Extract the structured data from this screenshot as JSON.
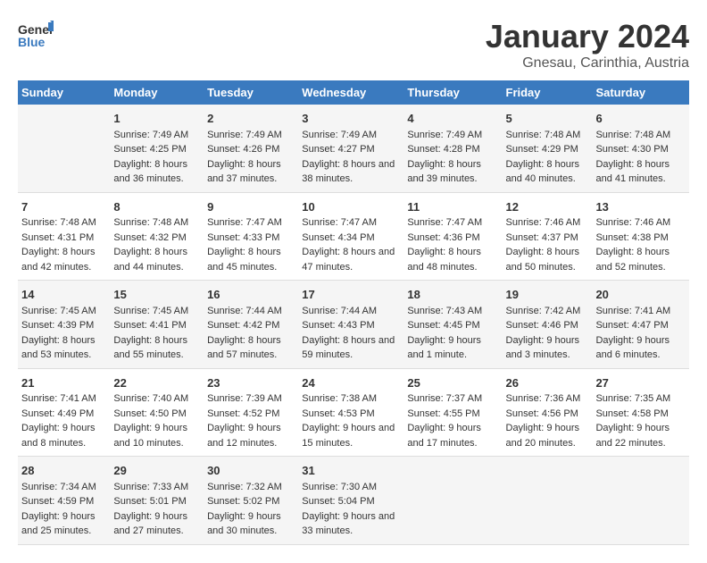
{
  "header": {
    "logo_general": "General",
    "logo_blue": "Blue",
    "main_title": "January 2024",
    "subtitle": "Gnesau, Carinthia, Austria"
  },
  "calendar": {
    "days_of_week": [
      "Sunday",
      "Monday",
      "Tuesday",
      "Wednesday",
      "Thursday",
      "Friday",
      "Saturday"
    ],
    "weeks": [
      [
        {
          "date": "",
          "sunrise": "",
          "sunset": "",
          "daylight": ""
        },
        {
          "date": "1",
          "sunrise": "Sunrise: 7:49 AM",
          "sunset": "Sunset: 4:25 PM",
          "daylight": "Daylight: 8 hours and 36 minutes."
        },
        {
          "date": "2",
          "sunrise": "Sunrise: 7:49 AM",
          "sunset": "Sunset: 4:26 PM",
          "daylight": "Daylight: 8 hours and 37 minutes."
        },
        {
          "date": "3",
          "sunrise": "Sunrise: 7:49 AM",
          "sunset": "Sunset: 4:27 PM",
          "daylight": "Daylight: 8 hours and 38 minutes."
        },
        {
          "date": "4",
          "sunrise": "Sunrise: 7:49 AM",
          "sunset": "Sunset: 4:28 PM",
          "daylight": "Daylight: 8 hours and 39 minutes."
        },
        {
          "date": "5",
          "sunrise": "Sunrise: 7:48 AM",
          "sunset": "Sunset: 4:29 PM",
          "daylight": "Daylight: 8 hours and 40 minutes."
        },
        {
          "date": "6",
          "sunrise": "Sunrise: 7:48 AM",
          "sunset": "Sunset: 4:30 PM",
          "daylight": "Daylight: 8 hours and 41 minutes."
        }
      ],
      [
        {
          "date": "7",
          "sunrise": "Sunrise: 7:48 AM",
          "sunset": "Sunset: 4:31 PM",
          "daylight": "Daylight: 8 hours and 42 minutes."
        },
        {
          "date": "8",
          "sunrise": "Sunrise: 7:48 AM",
          "sunset": "Sunset: 4:32 PM",
          "daylight": "Daylight: 8 hours and 44 minutes."
        },
        {
          "date": "9",
          "sunrise": "Sunrise: 7:47 AM",
          "sunset": "Sunset: 4:33 PM",
          "daylight": "Daylight: 8 hours and 45 minutes."
        },
        {
          "date": "10",
          "sunrise": "Sunrise: 7:47 AM",
          "sunset": "Sunset: 4:34 PM",
          "daylight": "Daylight: 8 hours and 47 minutes."
        },
        {
          "date": "11",
          "sunrise": "Sunrise: 7:47 AM",
          "sunset": "Sunset: 4:36 PM",
          "daylight": "Daylight: 8 hours and 48 minutes."
        },
        {
          "date": "12",
          "sunrise": "Sunrise: 7:46 AM",
          "sunset": "Sunset: 4:37 PM",
          "daylight": "Daylight: 8 hours and 50 minutes."
        },
        {
          "date": "13",
          "sunrise": "Sunrise: 7:46 AM",
          "sunset": "Sunset: 4:38 PM",
          "daylight": "Daylight: 8 hours and 52 minutes."
        }
      ],
      [
        {
          "date": "14",
          "sunrise": "Sunrise: 7:45 AM",
          "sunset": "Sunset: 4:39 PM",
          "daylight": "Daylight: 8 hours and 53 minutes."
        },
        {
          "date": "15",
          "sunrise": "Sunrise: 7:45 AM",
          "sunset": "Sunset: 4:41 PM",
          "daylight": "Daylight: 8 hours and 55 minutes."
        },
        {
          "date": "16",
          "sunrise": "Sunrise: 7:44 AM",
          "sunset": "Sunset: 4:42 PM",
          "daylight": "Daylight: 8 hours and 57 minutes."
        },
        {
          "date": "17",
          "sunrise": "Sunrise: 7:44 AM",
          "sunset": "Sunset: 4:43 PM",
          "daylight": "Daylight: 8 hours and 59 minutes."
        },
        {
          "date": "18",
          "sunrise": "Sunrise: 7:43 AM",
          "sunset": "Sunset: 4:45 PM",
          "daylight": "Daylight: 9 hours and 1 minute."
        },
        {
          "date": "19",
          "sunrise": "Sunrise: 7:42 AM",
          "sunset": "Sunset: 4:46 PM",
          "daylight": "Daylight: 9 hours and 3 minutes."
        },
        {
          "date": "20",
          "sunrise": "Sunrise: 7:41 AM",
          "sunset": "Sunset: 4:47 PM",
          "daylight": "Daylight: 9 hours and 6 minutes."
        }
      ],
      [
        {
          "date": "21",
          "sunrise": "Sunrise: 7:41 AM",
          "sunset": "Sunset: 4:49 PM",
          "daylight": "Daylight: 9 hours and 8 minutes."
        },
        {
          "date": "22",
          "sunrise": "Sunrise: 7:40 AM",
          "sunset": "Sunset: 4:50 PM",
          "daylight": "Daylight: 9 hours and 10 minutes."
        },
        {
          "date": "23",
          "sunrise": "Sunrise: 7:39 AM",
          "sunset": "Sunset: 4:52 PM",
          "daylight": "Daylight: 9 hours and 12 minutes."
        },
        {
          "date": "24",
          "sunrise": "Sunrise: 7:38 AM",
          "sunset": "Sunset: 4:53 PM",
          "daylight": "Daylight: 9 hours and 15 minutes."
        },
        {
          "date": "25",
          "sunrise": "Sunrise: 7:37 AM",
          "sunset": "Sunset: 4:55 PM",
          "daylight": "Daylight: 9 hours and 17 minutes."
        },
        {
          "date": "26",
          "sunrise": "Sunrise: 7:36 AM",
          "sunset": "Sunset: 4:56 PM",
          "daylight": "Daylight: 9 hours and 20 minutes."
        },
        {
          "date": "27",
          "sunrise": "Sunrise: 7:35 AM",
          "sunset": "Sunset: 4:58 PM",
          "daylight": "Daylight: 9 hours and 22 minutes."
        }
      ],
      [
        {
          "date": "28",
          "sunrise": "Sunrise: 7:34 AM",
          "sunset": "Sunset: 4:59 PM",
          "daylight": "Daylight: 9 hours and 25 minutes."
        },
        {
          "date": "29",
          "sunrise": "Sunrise: 7:33 AM",
          "sunset": "Sunset: 5:01 PM",
          "daylight": "Daylight: 9 hours and 27 minutes."
        },
        {
          "date": "30",
          "sunrise": "Sunrise: 7:32 AM",
          "sunset": "Sunset: 5:02 PM",
          "daylight": "Daylight: 9 hours and 30 minutes."
        },
        {
          "date": "31",
          "sunrise": "Sunrise: 7:30 AM",
          "sunset": "Sunset: 5:04 PM",
          "daylight": "Daylight: 9 hours and 33 minutes."
        },
        {
          "date": "",
          "sunrise": "",
          "sunset": "",
          "daylight": ""
        },
        {
          "date": "",
          "sunrise": "",
          "sunset": "",
          "daylight": ""
        },
        {
          "date": "",
          "sunrise": "",
          "sunset": "",
          "daylight": ""
        }
      ]
    ]
  }
}
